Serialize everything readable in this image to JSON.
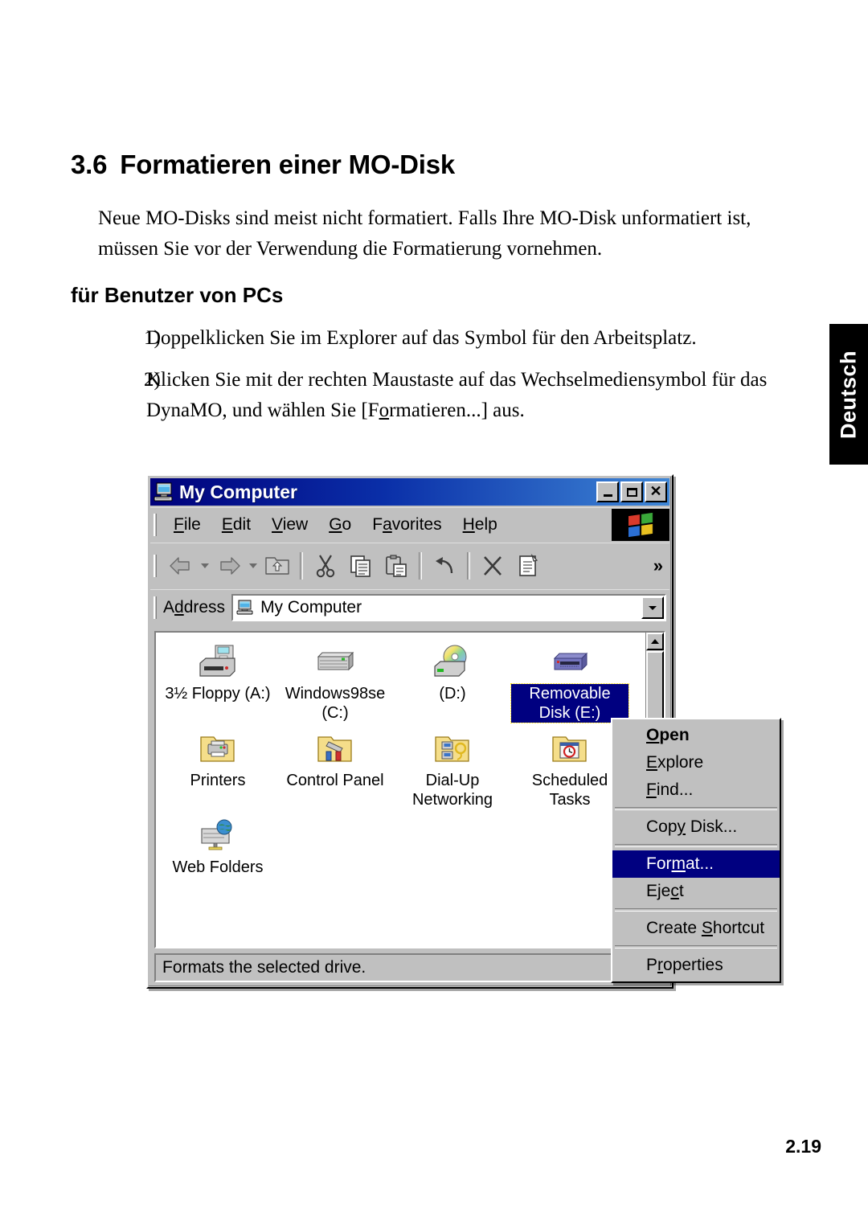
{
  "document": {
    "heading_number": "3.6",
    "heading_title": "Formatieren einer MO-Disk",
    "intro_paragraph": "Neue MO-Disks sind meist nicht formatiert. Falls Ihre MO-Disk unformatiert ist, müssen Sie vor der Verwendung die Formatierung vornehmen.",
    "subheading": "für Benutzer von PCs",
    "steps": [
      {
        "marker": "1)",
        "text": "Doppelklicken Sie im Explorer auf das Symbol für den Arbeitsplatz."
      },
      {
        "marker": "2)",
        "text_before": "Klicken Sie mit der rechten Maustaste auf das Wechselmediensymbol für das DynaMO, und wählen Sie [F",
        "text_underlined": "o",
        "text_after": "rmatieren...] aus."
      }
    ],
    "side_tab_label": "Deutsch",
    "page_number": "2.19"
  },
  "window": {
    "title": "My Computer",
    "title_icon": "my-computer-icon",
    "caption_buttons": {
      "minimize": "_",
      "maximize": "□",
      "close": "✕"
    },
    "menubar": [
      {
        "label_before": "",
        "mnemonic": "F",
        "label_after": "ile"
      },
      {
        "label_before": "",
        "mnemonic": "E",
        "label_after": "dit"
      },
      {
        "label_before": "",
        "mnemonic": "V",
        "label_after": "iew"
      },
      {
        "label_before": "",
        "mnemonic": "G",
        "label_after": "o"
      },
      {
        "label_before": "F",
        "mnemonic": "a",
        "label_after": "vorites"
      },
      {
        "label_before": "",
        "mnemonic": "H",
        "label_after": "elp"
      }
    ],
    "brand_logo": "windows-flag-logo",
    "toolbar_buttons": [
      "back-icon",
      "back-dropdown-icon",
      "forward-icon",
      "forward-dropdown-icon",
      "up-one-level-icon",
      "cut-icon",
      "copy-icon",
      "paste-icon",
      "undo-icon",
      "delete-icon",
      "properties-icon"
    ],
    "toolbar_overflow": "»",
    "address": {
      "label_before": "A",
      "label_mnemonic": "d",
      "label_after": "dress",
      "value": "My Computer",
      "icon": "my-computer-icon",
      "dropdown": "▼"
    },
    "items": [
      {
        "caption": "3½ Floppy (A:)",
        "icon": "floppy-drive-icon",
        "selected": false
      },
      {
        "caption": "Windows98se (C:)",
        "icon": "hard-disk-icon",
        "selected": false
      },
      {
        "caption": "(D:)",
        "icon": "cd-rom-drive-icon",
        "selected": false
      },
      {
        "caption": "Removable Disk (E:)",
        "icon": "removable-mo-disk-icon",
        "selected": true
      },
      {
        "caption": "Printers",
        "icon": "printers-folder-icon",
        "selected": false
      },
      {
        "caption": "Control Panel",
        "icon": "control-panel-folder-icon",
        "selected": false
      },
      {
        "caption": "Dial-Up Networking",
        "icon": "dialup-networking-folder-icon",
        "selected": false
      },
      {
        "caption": "Scheduled Tasks",
        "icon": "scheduled-tasks-folder-icon",
        "selected": false
      },
      {
        "caption": "Web Folders",
        "icon": "web-folders-icon",
        "selected": false
      }
    ],
    "statusbar_text": "Formats the selected drive.",
    "scrollbar": {
      "up": "▲",
      "down": "▼"
    }
  },
  "context_menu": [
    {
      "type": "item",
      "before": "",
      "mnemonic": "O",
      "after": "pen",
      "bold": true,
      "highlight": false
    },
    {
      "type": "item",
      "before": "",
      "mnemonic": "E",
      "after": "xplore",
      "bold": false,
      "highlight": false
    },
    {
      "type": "item",
      "before": "",
      "mnemonic": "F",
      "after": "ind...",
      "bold": false,
      "highlight": false
    },
    {
      "type": "separator"
    },
    {
      "type": "item",
      "before": "Cop",
      "mnemonic": "y",
      "after": " Disk...",
      "bold": false,
      "highlight": false
    },
    {
      "type": "separator"
    },
    {
      "type": "item",
      "before": "For",
      "mnemonic": "m",
      "after": "at...",
      "bold": false,
      "highlight": true
    },
    {
      "type": "item",
      "before": "Eje",
      "mnemonic": "c",
      "after": "t",
      "bold": false,
      "highlight": false
    },
    {
      "type": "separator"
    },
    {
      "type": "item",
      "before": "Create ",
      "mnemonic": "S",
      "after": "hortcut",
      "bold": false,
      "highlight": false
    },
    {
      "type": "separator"
    },
    {
      "type": "item",
      "before": "P",
      "mnemonic": "r",
      "after": "operties",
      "bold": false,
      "highlight": false
    }
  ],
  "colors": {
    "titlebar_start": "#00007b",
    "titlebar_end": "#3f87d6",
    "selection": "#000080",
    "face": "#c0c0c0",
    "tab_background": "#000000"
  }
}
